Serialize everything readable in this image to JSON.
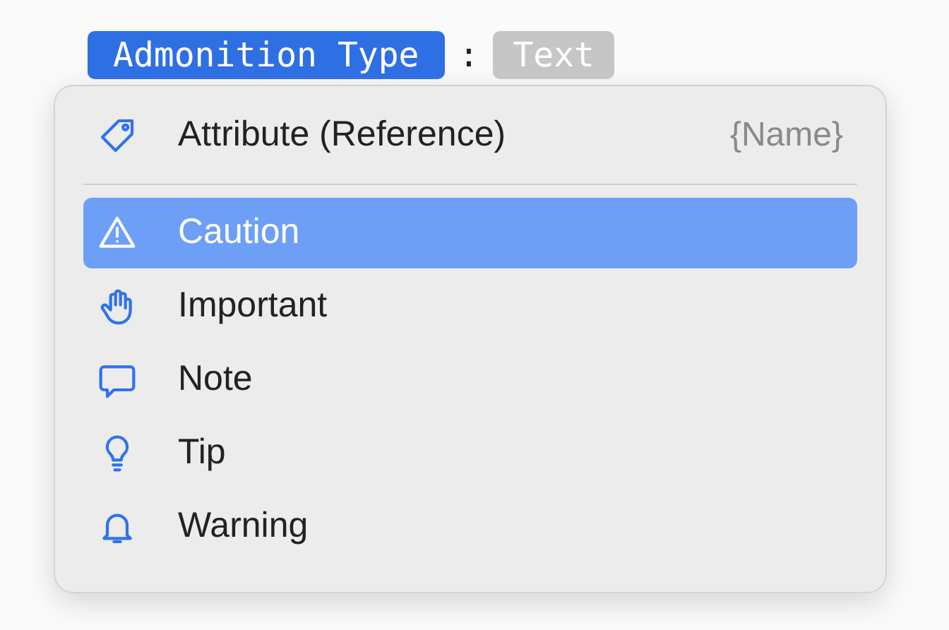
{
  "token": {
    "label": "Admonition Type",
    "separator": ":",
    "value": "Text"
  },
  "menu": {
    "sections": [
      [
        {
          "label": "Attribute (Reference)",
          "hint": "{Name}",
          "selected": false
        }
      ],
      [
        {
          "label": "Caution",
          "selected": true
        },
        {
          "label": "Important",
          "selected": false
        },
        {
          "label": "Note",
          "selected": false
        },
        {
          "label": "Tip",
          "selected": false
        },
        {
          "label": "Warning",
          "selected": false
        }
      ]
    ]
  }
}
